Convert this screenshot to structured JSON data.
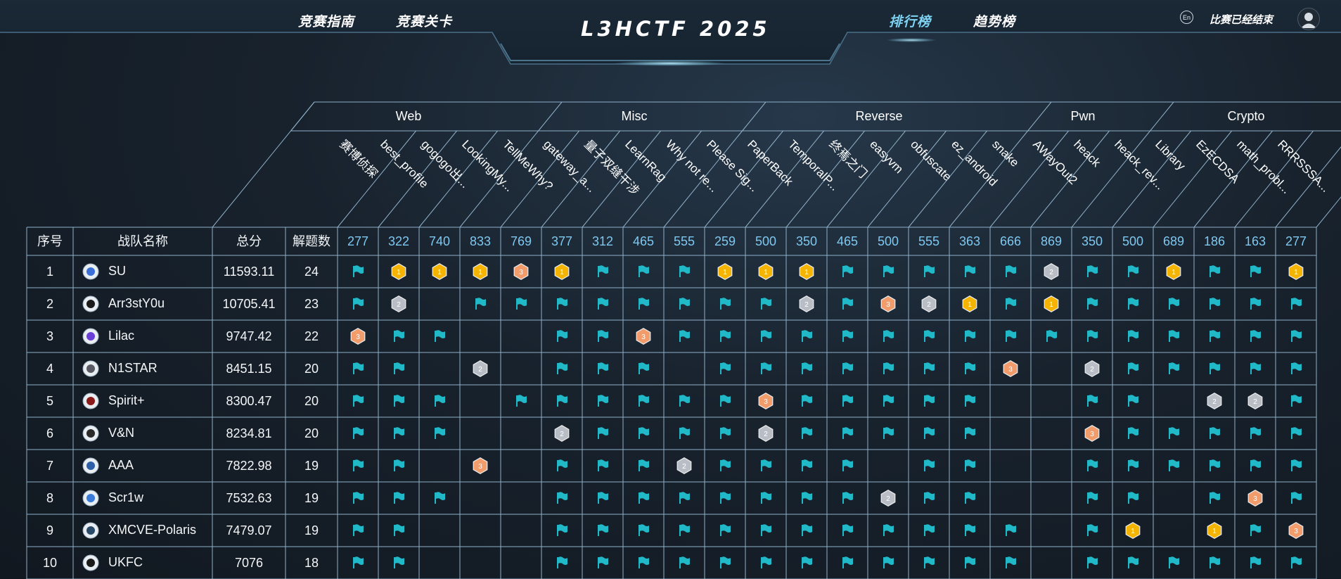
{
  "nav": {
    "guide": "竞赛指南",
    "challenges": "竞赛关卡",
    "title": "L3HCTF 2025",
    "ranking": "排行榜",
    "trend": "趋势榜",
    "lang": "En",
    "status": "比赛已经结束"
  },
  "colors": {
    "accent": "#7ed4f2",
    "flag": "#21b8c8",
    "gold": "#f4b400",
    "silver": "#b9bec6",
    "bronze": "#f39c6b",
    "grid": "#8fb0c8"
  },
  "table": {
    "headers": {
      "rank": "序号",
      "team": "战队名称",
      "score": "总分",
      "solves": "解题数"
    },
    "categories": [
      {
        "name": "Web",
        "span": 3
      },
      {
        "name": "Misc",
        "span": 5
      },
      {
        "name": "Reverse",
        "span": 7
      },
      {
        "name": "Pwn",
        "span": 3
      },
      {
        "name": "Crypto",
        "span": 5
      }
    ],
    "challenges": [
      {
        "name": "赛博侦探",
        "points": "277"
      },
      {
        "name": "best_profile",
        "points": "322"
      },
      {
        "name": "gogogo出...",
        "points": "740"
      },
      {
        "name": "LookingMy...",
        "points": "833"
      },
      {
        "name": "TellMeWhy?",
        "points": "769"
      },
      {
        "name": "gateway_a...",
        "points": "377"
      },
      {
        "name": "量子双缝干涉",
        "points": "312"
      },
      {
        "name": "LearnRag",
        "points": "465"
      },
      {
        "name": "Why not re...",
        "points": "555"
      },
      {
        "name": "Please Sig...",
        "points": "259"
      },
      {
        "name": "PaperBack",
        "points": "500"
      },
      {
        "name": "TemporalP...",
        "points": "350"
      },
      {
        "name": "终焉之门",
        "points": "465"
      },
      {
        "name": "easyvm",
        "points": "500"
      },
      {
        "name": "obfuscate",
        "points": "555"
      },
      {
        "name": "ez_android",
        "points": "363"
      },
      {
        "name": "snake",
        "points": "666"
      },
      {
        "name": "AWayOut2",
        "points": "869"
      },
      {
        "name": "heack",
        "points": "350"
      },
      {
        "name": "heack_rev...",
        "points": "500"
      },
      {
        "name": "Library",
        "points": "689"
      },
      {
        "name": "EzECDSA",
        "points": "186"
      },
      {
        "name": "math_probl...",
        "points": "163"
      },
      {
        "name": "RRRSSSA...",
        "points": "277"
      }
    ],
    "rows": [
      {
        "rank": "1",
        "team": "SU",
        "score": "11593.11",
        "solves": "24",
        "logo": "su-logo",
        "marks": [
          "f",
          "1",
          "1",
          "1",
          "3",
          "1",
          "f",
          "f",
          "f",
          "1",
          "1",
          "1",
          "f",
          "f",
          "f",
          "f",
          "f",
          "2",
          "f",
          "f",
          "1",
          "f",
          "f",
          "1"
        ]
      },
      {
        "rank": "2",
        "team": "Arr3stY0u",
        "score": "10705.41",
        "solves": "23",
        "logo": "arr3sty0u-logo",
        "marks": [
          "f",
          "2",
          "",
          "f",
          "f",
          "f",
          "f",
          "f",
          "f",
          "f",
          "f",
          "2",
          "f",
          "3",
          "2",
          "1",
          "f",
          "1",
          "f",
          "f",
          "f",
          "f",
          "f",
          "f"
        ]
      },
      {
        "rank": "3",
        "team": "Lilac",
        "score": "9747.42",
        "solves": "22",
        "logo": "lilac-logo",
        "marks": [
          "3",
          "f",
          "f",
          "",
          "",
          "f",
          "f",
          "3",
          "f",
          "f",
          "f",
          "f",
          "f",
          "f",
          "f",
          "f",
          "f",
          "f",
          "f",
          "f",
          "f",
          "f",
          "f",
          "f"
        ]
      },
      {
        "rank": "4",
        "team": "N1STAR",
        "score": "8451.15",
        "solves": "20",
        "logo": "n1star-logo",
        "marks": [
          "f",
          "f",
          "",
          "2",
          "",
          "f",
          "f",
          "f",
          "",
          "f",
          "f",
          "f",
          "f",
          "f",
          "f",
          "f",
          "3",
          "",
          "2",
          "f",
          "f",
          "f",
          "f",
          "f"
        ]
      },
      {
        "rank": "5",
        "team": "Spirit+",
        "score": "8300.47",
        "solves": "20",
        "logo": "spirit-logo",
        "marks": [
          "f",
          "f",
          "f",
          "",
          "f",
          "f",
          "f",
          "f",
          "f",
          "f",
          "3",
          "f",
          "f",
          "f",
          "f",
          "f",
          "",
          "",
          "f",
          "f",
          "",
          "2",
          "2",
          "f"
        ]
      },
      {
        "rank": "6",
        "team": "V&N",
        "score": "8234.81",
        "solves": "20",
        "logo": "vn-logo",
        "marks": [
          "f",
          "f",
          "f",
          "",
          "",
          "2",
          "f",
          "f",
          "f",
          "f",
          "2",
          "f",
          "f",
          "f",
          "f",
          "f",
          "",
          "",
          "3",
          "f",
          "f",
          "f",
          "f",
          "f"
        ]
      },
      {
        "rank": "7",
        "team": "AAA",
        "score": "7822.98",
        "solves": "19",
        "logo": "aaa-logo",
        "marks": [
          "f",
          "f",
          "",
          "3",
          "",
          "f",
          "f",
          "f",
          "2",
          "f",
          "f",
          "f",
          "f",
          "",
          "f",
          "f",
          "",
          "",
          "f",
          "f",
          "f",
          "f",
          "f",
          "f"
        ]
      },
      {
        "rank": "8",
        "team": "Scr1w",
        "score": "7532.63",
        "solves": "19",
        "logo": "scr1w-logo",
        "marks": [
          "f",
          "f",
          "f",
          "",
          "",
          "f",
          "f",
          "f",
          "f",
          "f",
          "f",
          "f",
          "f",
          "2",
          "f",
          "f",
          "",
          "",
          "f",
          "f",
          "",
          "f",
          "3",
          "f"
        ]
      },
      {
        "rank": "9",
        "team": "XMCVE-Polaris",
        "score": "7479.07",
        "solves": "19",
        "logo": "xmcve-logo",
        "marks": [
          "f",
          "f",
          "",
          "",
          "",
          "f",
          "f",
          "f",
          "f",
          "f",
          "f",
          "f",
          "f",
          "f",
          "f",
          "f",
          "f",
          "",
          "f",
          "1",
          "",
          "1",
          "f",
          "3"
        ]
      },
      {
        "rank": "10",
        "team": "UKFC",
        "score": "7076",
        "solves": "18",
        "logo": "ukfc-logo",
        "marks": [
          "f",
          "f",
          "",
          "",
          "",
          "f",
          "f",
          "f",
          "f",
          "f",
          "f",
          "f",
          "f",
          "f",
          "f",
          "f",
          "f",
          "",
          "f",
          "f",
          "f",
          "f",
          "f",
          "f"
        ]
      }
    ]
  }
}
